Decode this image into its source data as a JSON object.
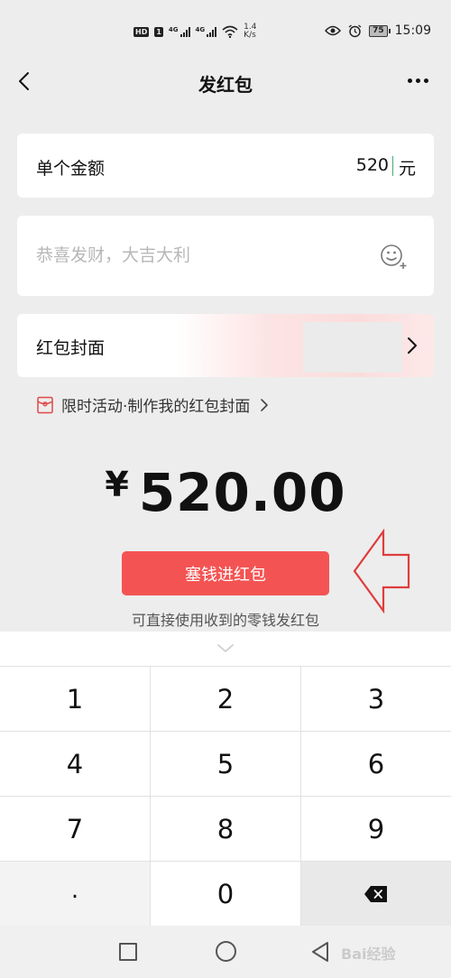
{
  "status_bar": {
    "hd_badge": "HD",
    "sim_badge": "1",
    "network_1": "4G",
    "network_2": "4G",
    "speed_value": "1.4",
    "speed_unit": "K/s",
    "battery": "75",
    "time": "15:09"
  },
  "nav": {
    "title": "发红包"
  },
  "amount": {
    "label": "单个金额",
    "value": "520",
    "unit": "元"
  },
  "blessing": {
    "placeholder": "恭喜发财，大吉大利"
  },
  "cover": {
    "label": "红包封面"
  },
  "promo": {
    "text": "限时活动·制作我的红包封面"
  },
  "total": {
    "currency": "¥",
    "amount": "520.00"
  },
  "submit": {
    "label": "塞钱进红包"
  },
  "hint": "可直接使用收到的零钱发红包",
  "keypad": {
    "rows": [
      [
        "1",
        "2",
        "3"
      ],
      [
        "4",
        "5",
        "6"
      ],
      [
        "7",
        "8",
        "9"
      ],
      [
        ".",
        "0",
        "delete"
      ]
    ]
  },
  "watermark": "Bai经验",
  "colors": {
    "accent_red": "#f35453",
    "background": "#ededed"
  }
}
